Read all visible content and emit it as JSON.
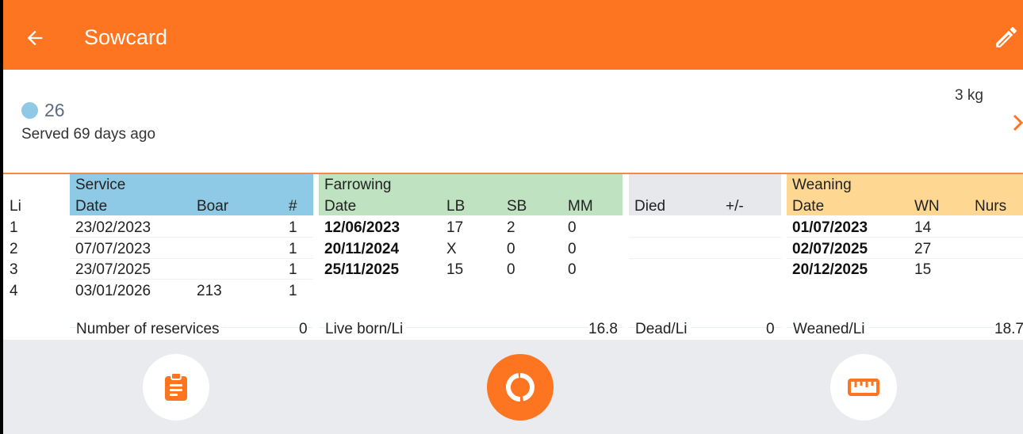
{
  "appbar": {
    "title": "Sowcard",
    "back_icon": "arrow-back-icon",
    "edit_icon": "pencil-icon",
    "color": "#fd7421"
  },
  "sow": {
    "number": "26",
    "status": "Served 69 days ago",
    "weight": "3 kg",
    "dot_color": "#8ecae6"
  },
  "table": {
    "li_header": "Li",
    "service": {
      "title": "Service",
      "date": "Date",
      "boar": "Boar",
      "count": "#"
    },
    "farrowing": {
      "title": "Farrowing",
      "date": "Date",
      "lb": "LB",
      "sb": "SB",
      "mm": "MM"
    },
    "died": {
      "died": "Died",
      "plusminus": "+/-"
    },
    "weaning": {
      "title": "Weaning",
      "date": "Date",
      "wn": "WN",
      "nurs": "Nurs"
    },
    "rows": [
      {
        "li": "1",
        "sdate": "23/02/2023",
        "boar": "",
        "count": "1",
        "fdate": "12/06/2023",
        "lb": "17",
        "sb": "2",
        "mm": "0",
        "wdate": "01/07/2023",
        "wn": "14"
      },
      {
        "li": "2",
        "sdate": "07/07/2023",
        "boar": "",
        "count": "1",
        "fdate": "20/11/2024",
        "lb": "X",
        "sb": "0",
        "mm": "0",
        "wdate": "02/07/2025",
        "wn": "27"
      },
      {
        "li": "3",
        "sdate": "23/07/2025",
        "boar": "",
        "count": "1",
        "fdate": "25/11/2025",
        "lb": "15",
        "sb": "0",
        "mm": "0",
        "wdate": "20/12/2025",
        "wn": "15"
      },
      {
        "li": "4",
        "sdate": "03/01/2026",
        "boar": "213",
        "count": "1",
        "fdate": "",
        "lb": "",
        "sb": "",
        "mm": "",
        "wdate": "",
        "wn": ""
      }
    ],
    "footer": {
      "reservices_label": "Number of reservices",
      "reservices_value": "0",
      "liveborn_label": "Live born/Li",
      "liveborn_value": "16.8",
      "dead_label": "Dead/Li",
      "dead_value": "0",
      "weaned_label": "Weaned/Li",
      "weaned_value": "18.7"
    }
  },
  "actions": [
    {
      "icon": "clipboard-icon"
    },
    {
      "icon": "cycle-icon"
    },
    {
      "icon": "ruler-icon"
    }
  ]
}
